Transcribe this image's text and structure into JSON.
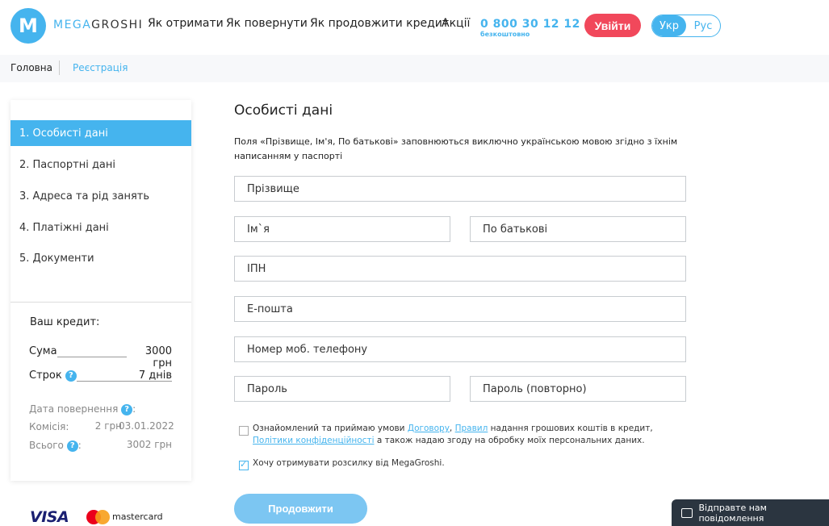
{
  "header": {
    "logo_mark": "M",
    "logo_mega": "MEGA",
    "logo_groshi": "GROSHI",
    "nav": [
      "Як отримати",
      "Як повернути",
      "Як продовжити кредит",
      "Акції"
    ],
    "phone": "0 800 30 12 12",
    "phone_note": "безкоштовно",
    "login": "Увійти",
    "lang_active": "Укр",
    "lang_other": "Рус"
  },
  "breadcrumb": {
    "home": "Головна",
    "current": "Реєстрація"
  },
  "sidebar": {
    "steps": [
      "1. Особисті дані",
      "2. Паспортні дані",
      "3. Адреса та рід занять",
      "4. Платіжні дані",
      "5. Документи"
    ],
    "credit_title": "Ваш кредит:",
    "sum_label": "Сума",
    "sum_value": "3000 грн",
    "term_label": "Строк",
    "term_value": "7 днів",
    "return_date_label": "Дата повернення",
    "return_date_value": "03.01.2022",
    "fee_label": "Комісія:",
    "fee_value": "2 грн",
    "total_label": "Всього",
    "total_value": "3002 грн",
    "help_glyph": "?"
  },
  "payments": {
    "visa": "VISA",
    "mastercard": "mastercard"
  },
  "form": {
    "title": "Особисті дані",
    "note": "Поля «Прізвище, Ім'я, По батькові» заповнюються виключно українською мовою згідно з їхнім написанням у паспорті",
    "placeholders": {
      "surname": "Прізвище",
      "name": "Ім`я",
      "patronymic": "По батькові",
      "ipn": "ІПН",
      "email": "Е-пошта",
      "phone": "Номер моб. телефону",
      "password": "Пароль",
      "password_repeat": "Пароль (повторно)"
    },
    "agree_prefix": "Ознайомлений та приймаю умови ",
    "agree_contract": "Договору",
    "agree_comma": ", ",
    "agree_rules": "Правил",
    "agree_mid": " надання грошових коштів в кредит, ",
    "agree_policy": "Політики конфіденційності",
    "agree_suffix": " а також надаю згоду на обробку моїх персональних даних.",
    "agree_checked": false,
    "newsletter": "Хочу отримувати розсилку від MegaGroshi.",
    "newsletter_checked": true,
    "continue": "Продовжити"
  },
  "chat": {
    "label": "Відправте нам повідомлення"
  },
  "colors": {
    "accent": "#45b4ee",
    "login": "#f1485b",
    "chat_bg": "#2b3540"
  }
}
